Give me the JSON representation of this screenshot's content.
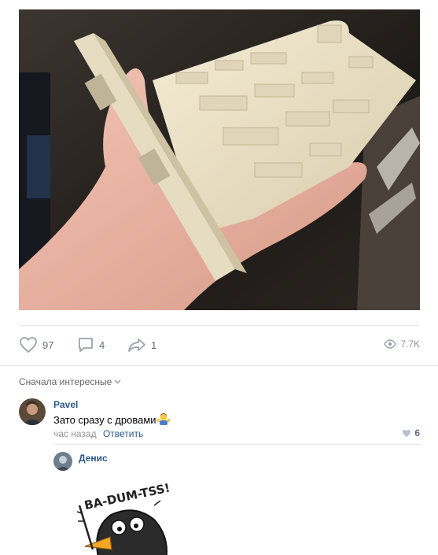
{
  "post": {
    "photo_icon": "wooden-graphics-card-photo"
  },
  "actions": {
    "likes": "97",
    "comments": "4",
    "shares": "1",
    "views": "7.7K"
  },
  "comments_section": {
    "sort_label": "Сначала интересные"
  },
  "comment": {
    "author": "Pavel",
    "text": "Зато сразу с дровами",
    "time": "час назад",
    "reply_label": "Ответить",
    "likes": "6"
  },
  "reply": {
    "author": "Денис",
    "sticker_text": "BA-DUM-TSS!"
  },
  "colors": {
    "link": "#2a5885",
    "meta": "#939393",
    "icon": "#99a2ad",
    "separator": "#e7e8ec"
  }
}
